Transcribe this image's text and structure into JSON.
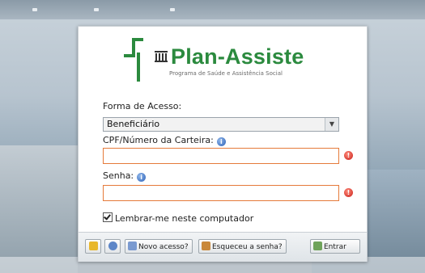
{
  "brand": {
    "name": "Plan-Assiste",
    "tagline": "Programa de Saúde e Assistência Social"
  },
  "form": {
    "access_label": "Forma de Acesso:",
    "access_selected": "Beneficiário",
    "cpf_label": "CPF/Número da Carteira:",
    "cpf_value": "",
    "password_label": "Senha:",
    "password_value": "",
    "remember_label": "Lembrar-me neste computador",
    "remember_checked": true
  },
  "toolbar": {
    "new_access": "Novo acesso?",
    "forgot_password": "Esqueceu a senha?",
    "enter": "Entrar"
  },
  "colors": {
    "brand_green": "#2b8a3e",
    "error_red": "#c8201a",
    "field_border_error": "#e57a3a",
    "info_blue": "#2f63b8"
  }
}
